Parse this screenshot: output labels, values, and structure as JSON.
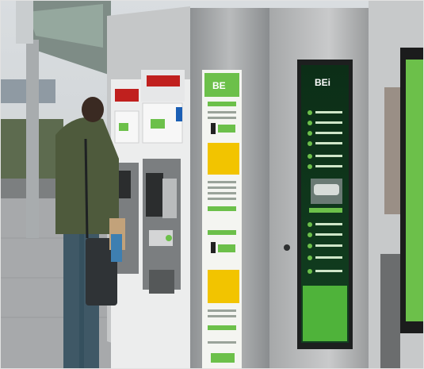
{
  "panel_logo": "BE",
  "screen_logo": "BEi",
  "colors": {
    "brand_green": "#6cc04a",
    "dark_green": "#0f3a1e",
    "panel_yellow": "#f2c400",
    "steel": "#a9abac",
    "display_red": "#c0201e"
  }
}
